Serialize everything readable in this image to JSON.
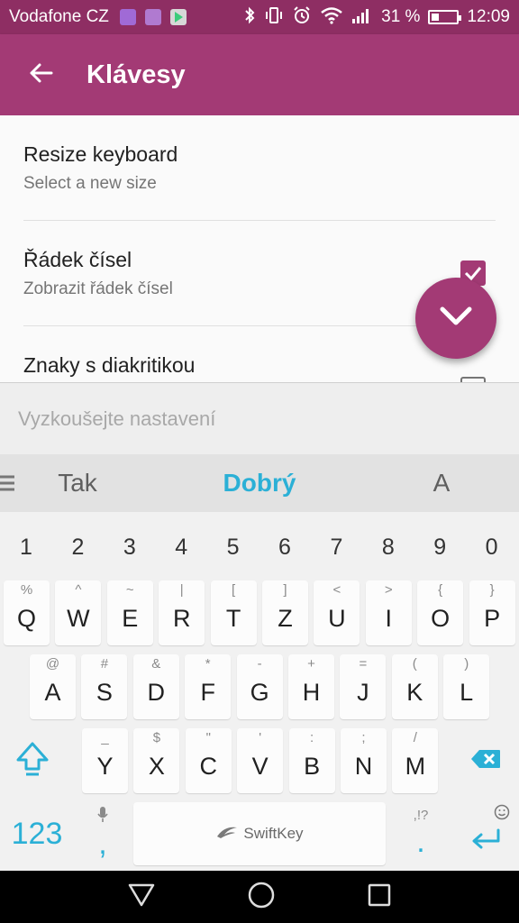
{
  "status_bar": {
    "carrier": "Vodafone CZ",
    "battery_percent": "31 %",
    "battery_level": 0.31,
    "time": "12:09",
    "icons": [
      "keyboard-notification-icon",
      "gallery-notification-icon",
      "play-store-notification-icon",
      "bluetooth-icon",
      "vibrate-icon",
      "alarm-icon",
      "wifi-icon",
      "signal-icon",
      "battery-icon"
    ]
  },
  "toolbar": {
    "title": "Klávesy",
    "back_icon": "arrow-back-icon"
  },
  "settings": [
    {
      "title": "Resize keyboard",
      "subtitle": "Select a new size"
    },
    {
      "title": "Řádek čísel",
      "subtitle": "Zobrazit řádek čísel",
      "checked": true
    },
    {
      "title": "Znaky s diakritikou",
      "checked": false
    }
  ],
  "fab": {
    "icon": "chevron-down-icon"
  },
  "try_field": {
    "placeholder": "Vyzkoušejte nastavení"
  },
  "keyboard": {
    "suggestions": [
      "Tak",
      "Dobrý",
      "A"
    ],
    "number_row": [
      "1",
      "2",
      "3",
      "4",
      "5",
      "6",
      "7",
      "8",
      "9",
      "0"
    ],
    "row1": [
      {
        "key": "Q",
        "hint": "%"
      },
      {
        "key": "W",
        "hint": "^"
      },
      {
        "key": "E",
        "hint": "~"
      },
      {
        "key": "R",
        "hint": "|"
      },
      {
        "key": "T",
        "hint": "["
      },
      {
        "key": "Z",
        "hint": "]"
      },
      {
        "key": "U",
        "hint": "<"
      },
      {
        "key": "I",
        "hint": ">"
      },
      {
        "key": "O",
        "hint": "{"
      },
      {
        "key": "P",
        "hint": "}"
      }
    ],
    "row2": [
      {
        "key": "A",
        "hint": "@"
      },
      {
        "key": "S",
        "hint": "#"
      },
      {
        "key": "D",
        "hint": "&"
      },
      {
        "key": "F",
        "hint": "*"
      },
      {
        "key": "G",
        "hint": "-"
      },
      {
        "key": "H",
        "hint": "+"
      },
      {
        "key": "J",
        "hint": "="
      },
      {
        "key": "K",
        "hint": "("
      },
      {
        "key": "L",
        "hint": ")"
      }
    ],
    "row3": [
      {
        "key": "Y",
        "hint": "_"
      },
      {
        "key": "X",
        "hint": "$"
      },
      {
        "key": "C",
        "hint": "\""
      },
      {
        "key": "V",
        "hint": "'"
      },
      {
        "key": "B",
        "hint": ":"
      },
      {
        "key": "N",
        "hint": ";"
      },
      {
        "key": "M",
        "hint": "/"
      }
    ],
    "bottom": {
      "numbers_key": "123",
      "comma_key": ",",
      "space_label": "SwiftKey",
      "period_key": ".",
      "period_hint": ",!?",
      "emoji_icon": "smiley-icon",
      "mic_icon": "mic-icon",
      "enter_icon": "enter-icon"
    }
  },
  "nav_bar": {
    "icons": [
      "back-triangle-icon",
      "home-circle-icon",
      "recents-square-icon"
    ]
  },
  "colors": {
    "status_bar": "#8e2e63",
    "toolbar": "#a33a75",
    "accent": "#a33a75",
    "swiftkey_blue": "#2bb0d6",
    "suggestion_bar": "#e2e2e2",
    "keyboard_bg": "#f1f1f1"
  }
}
